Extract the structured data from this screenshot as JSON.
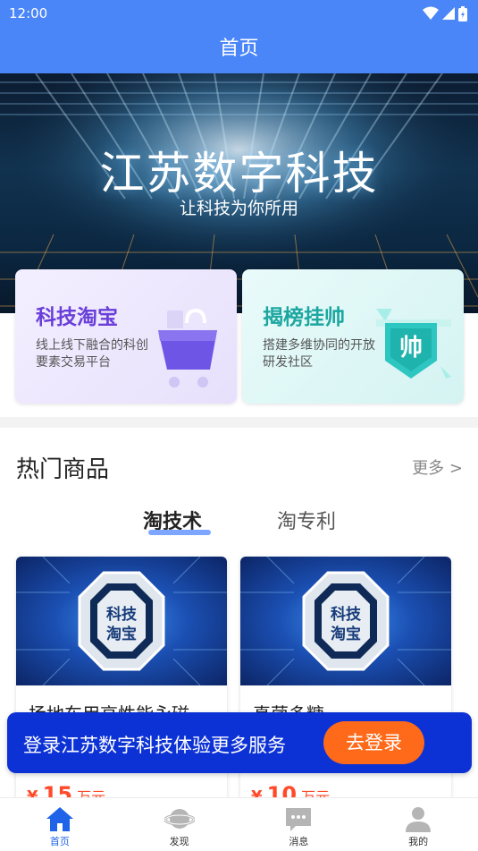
{
  "status_bar": {
    "time": "12:00"
  },
  "app_bar": {
    "title": "首页"
  },
  "hero": {
    "title": "江苏数字科技",
    "subtitle": "让科技为你所用"
  },
  "features": [
    {
      "title": "科技淘宝",
      "desc": "线上线下融合的科创要素交易平台",
      "icon": "shopping-cart-icon"
    },
    {
      "title": "揭榜挂帅",
      "desc": "搭建多维协同的开放研发社区",
      "icon": "shuai-badge-icon",
      "badge_text": "帅"
    }
  ],
  "hot_goods": {
    "title": "热门商品",
    "more_label": "更多 >",
    "tabs": [
      {
        "label": "淘技术",
        "active": true
      },
      {
        "label": "淘专利",
        "active": false
      }
    ],
    "logo_text": [
      "科技",
      "淘宝"
    ],
    "products": [
      {
        "name": "扬地车用高性能永磁",
        "price_symbol": "¥",
        "price": "15",
        "unit": "万元"
      },
      {
        "name": "真菌多糖",
        "price_symbol": "¥",
        "price": "10",
        "unit": "万元"
      }
    ]
  },
  "login_banner": {
    "text": "登录江苏数字科技体验更多服务",
    "button": "去登录"
  },
  "bottom_nav": [
    {
      "label": "首页",
      "icon": "home-icon",
      "active": true
    },
    {
      "label": "发现",
      "icon": "planet-icon",
      "active": false
    },
    {
      "label": "消息",
      "icon": "message-icon",
      "active": false
    },
    {
      "label": "我的",
      "icon": "user-icon",
      "active": false
    }
  ],
  "colors": {
    "primary": "#4a86f7",
    "login_banner": "#0c32d6",
    "login_button": "#fe6a1a",
    "price": "#ff4a2a",
    "feature1_title": "#6a3fd9",
    "feature2_title": "#1ba7a0",
    "nav_active": "#1f63e8"
  }
}
